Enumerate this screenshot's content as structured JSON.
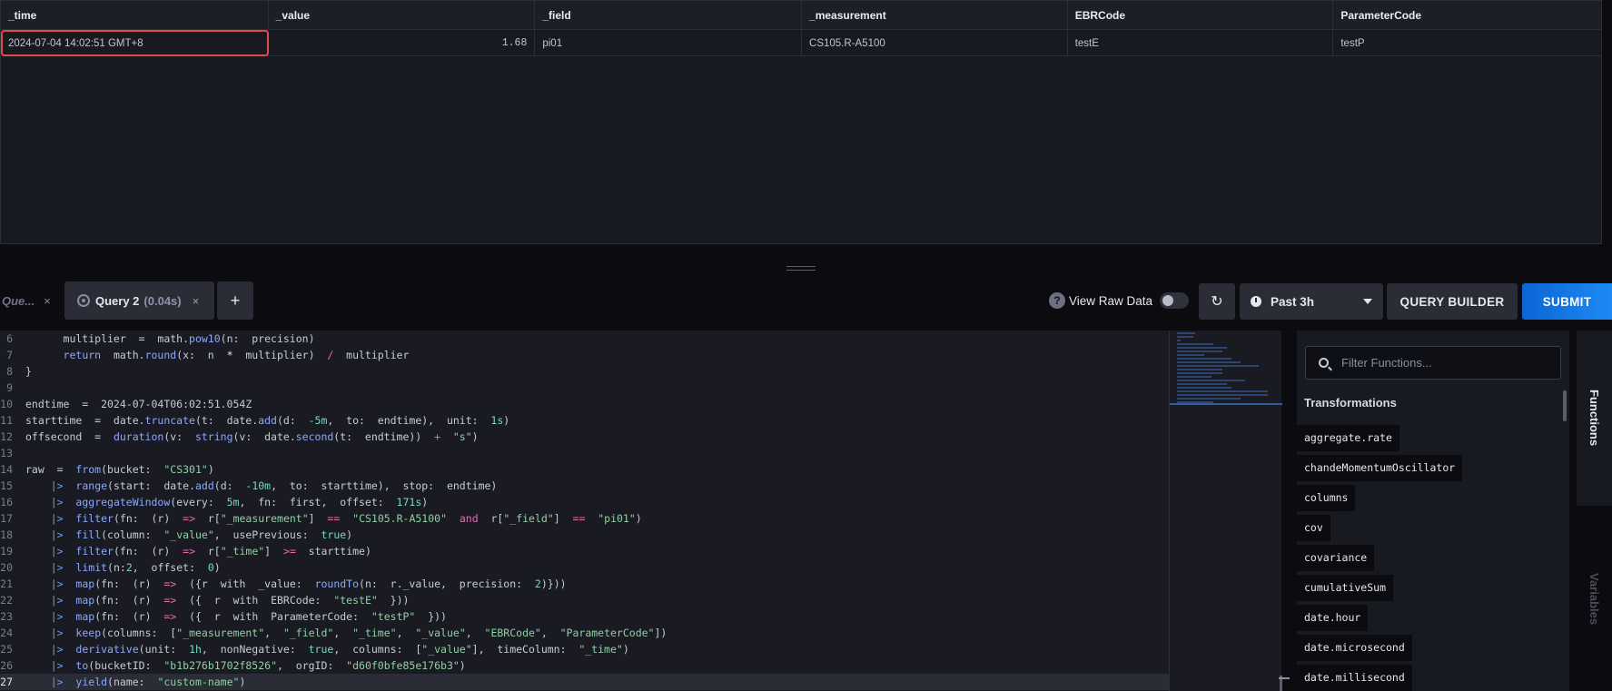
{
  "results": {
    "columns": [
      "_time",
      "_value",
      "_field",
      "_measurement",
      "EBRCode",
      "ParameterCode"
    ],
    "rows": [
      [
        "2024-07-04 14:02:51 GMT+8",
        "1.68",
        "pi01",
        "CS105.R-A5100",
        "testE",
        "testP"
      ]
    ]
  },
  "tabs": {
    "inactive": {
      "label": "Que...",
      "close": "×"
    },
    "active": {
      "label": "Query 2",
      "time": "(0.04s)",
      "close": "×"
    },
    "add": "+"
  },
  "toolbar": {
    "raw_help": "?",
    "raw_label": "View Raw Data",
    "refresh_icon": "↻",
    "time_range": "Past 3h",
    "query_builder": "QUERY BUILDER",
    "submit": "SUBMIT"
  },
  "editor": {
    "lines": [
      {
        "n": "6"
      },
      {
        "n": "7"
      },
      {
        "n": "8"
      },
      {
        "n": "9"
      },
      {
        "n": "10"
      },
      {
        "n": "11"
      },
      {
        "n": "12"
      },
      {
        "n": "13"
      },
      {
        "n": "14"
      },
      {
        "n": "15"
      },
      {
        "n": "16"
      },
      {
        "n": "17"
      },
      {
        "n": "18"
      },
      {
        "n": "19"
      },
      {
        "n": "20"
      },
      {
        "n": "21"
      },
      {
        "n": "22"
      },
      {
        "n": "23"
      },
      {
        "n": "24"
      },
      {
        "n": "25"
      },
      {
        "n": "26"
      },
      {
        "n": "27"
      }
    ]
  },
  "functions": {
    "search_placeholder": "Filter Functions...",
    "section": "Transformations",
    "items": [
      "aggregate.rate",
      "chandeMomentumOscillator",
      "columns",
      "cov",
      "covariance",
      "cumulativeSum",
      "date.hour",
      "date.microsecond",
      "date.millisecond"
    ]
  },
  "sidebar_tabs": {
    "functions": "Functions",
    "variables": "Variables"
  },
  "colors": {
    "accent": "#1d8af5",
    "highlight": "#e24a4a"
  }
}
